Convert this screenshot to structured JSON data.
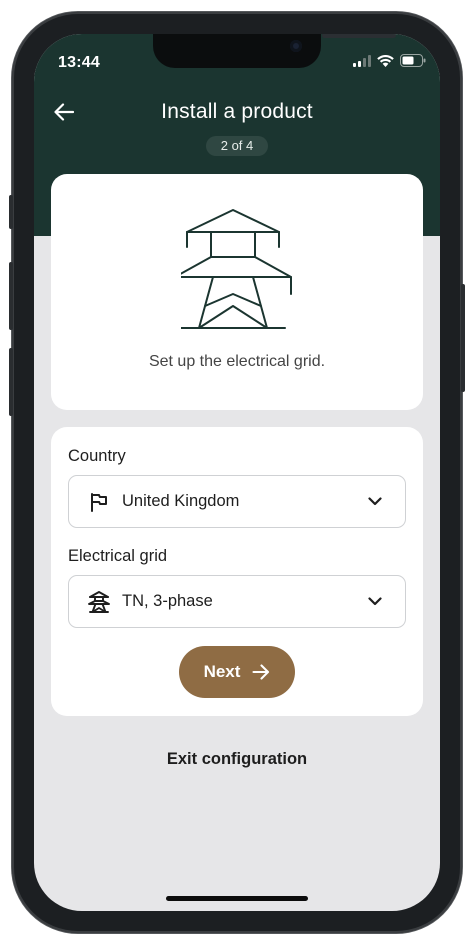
{
  "status_bar": {
    "time": "13:44",
    "icons": [
      "signal-icon",
      "wifi-icon",
      "battery-icon"
    ]
  },
  "header": {
    "title": "Install a product",
    "step": "2 of 4",
    "back_icon": "arrow-left-icon"
  },
  "illustration": {
    "icon": "electricity-pylon-icon",
    "caption": "Set up the electrical grid."
  },
  "form": {
    "country": {
      "label": "Country",
      "value": "United Kingdom",
      "icon": "flag-icon"
    },
    "grid": {
      "label": "Electrical grid",
      "value": "TN, 3-phase",
      "icon": "pylon-icon"
    },
    "next_label": "Next"
  },
  "footer": {
    "exit_label": "Exit configuration"
  },
  "colors": {
    "header_bg": "#1b3530",
    "page_bg": "#e6e6e8",
    "accent": "#8f6c44"
  }
}
